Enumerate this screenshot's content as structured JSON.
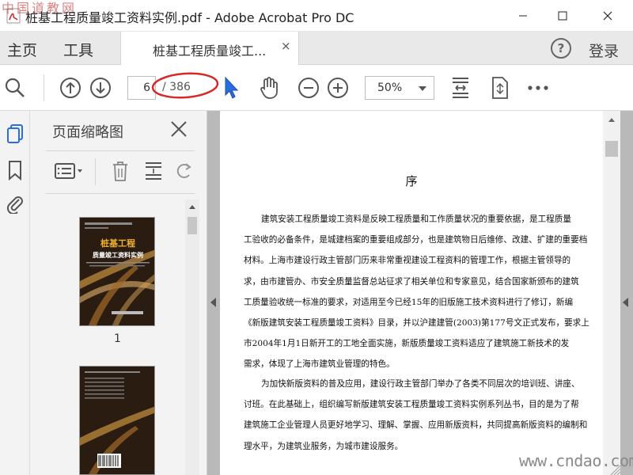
{
  "window": {
    "title": "桩基工程质量竣工资料实例.pdf - Adobe Acrobat Pro DC",
    "watermark_top_left": "中国道教网",
    "controls": {
      "minimize": "minimize",
      "maximize": "maximize",
      "close": "close"
    }
  },
  "tabbar": {
    "home_label": "主页",
    "tools_label": "工具",
    "doc_tab_label": "桩基工程质量竣工...",
    "doc_tab_close": "×",
    "help_label": "?",
    "login_label": "登录"
  },
  "toolbar": {
    "current_page": "6",
    "total_pages": "/ 386",
    "zoom": "50%",
    "icons": [
      "search-icon",
      "page-up-icon",
      "page-down-icon",
      "select-cursor-icon",
      "hand-icon",
      "zoom-out-icon",
      "zoom-in-icon",
      "fit-page-icon",
      "rotate-icon",
      "more-icon"
    ],
    "annotation_color": "#d62a2a",
    "cursor_color": "#2a6de0"
  },
  "side_rail": {
    "icons": [
      "page-thumbnails-icon",
      "bookmark-icon",
      "attachment-icon"
    ]
  },
  "thumbnail_panel": {
    "title": "页面缩略图",
    "thumbnails": [
      {
        "page_label": "1",
        "cover_title_line1": "桩基工程",
        "cover_title_line2": "质量竣工资料实例"
      }
    ]
  },
  "document": {
    "heading": "序",
    "paragraph1_lines": [
      "建筑安装工程质量竣工资料是反映工程质量和工作质量状况的重要依据，是工程质量",
      "工验收的必备条件，是城建档案的重要组成部分，也是建筑物日后维修、改建、扩建的重要档",
      "材料。上海市建设行政主管部门历来非常重视建设工程资料的管理工作，根据主管领导的",
      "求，由市建管办、市安全质量监督总站征求了相关单位和专家意见，结合国家新颁布的建筑",
      "工质量验收统一标准的要求，对适用至今已经15年的旧版施工技术资料进行了修订，新编",
      "《新版建筑安装工程质量竣工资料》目录，并以沪建建管(2003)第177号文正式发布，要求上",
      "市2004年1月1日新开工的工地全面实施，新版质量竣工资料适应了建筑施工新技术的发",
      "需求，体现了上海市建筑业管理的特色。"
    ],
    "paragraph2_lines": [
      "为加快新版资料的普及应用，建设行政主管部门举办了各类不同层次的培训班、讲座、",
      "讨班。在此基础上，组织编写新版建筑安装工程质量竣工资料实例系列丛书，目的是为了帮",
      "建筑施工企业管理人员更好地学习、理解、掌握、应用新版资料，共同提高新版资料的编制和",
      "理水平，为建筑业服务，为城市建设服务。"
    ]
  },
  "watermark_bottom_right": "www.cndao.com"
}
